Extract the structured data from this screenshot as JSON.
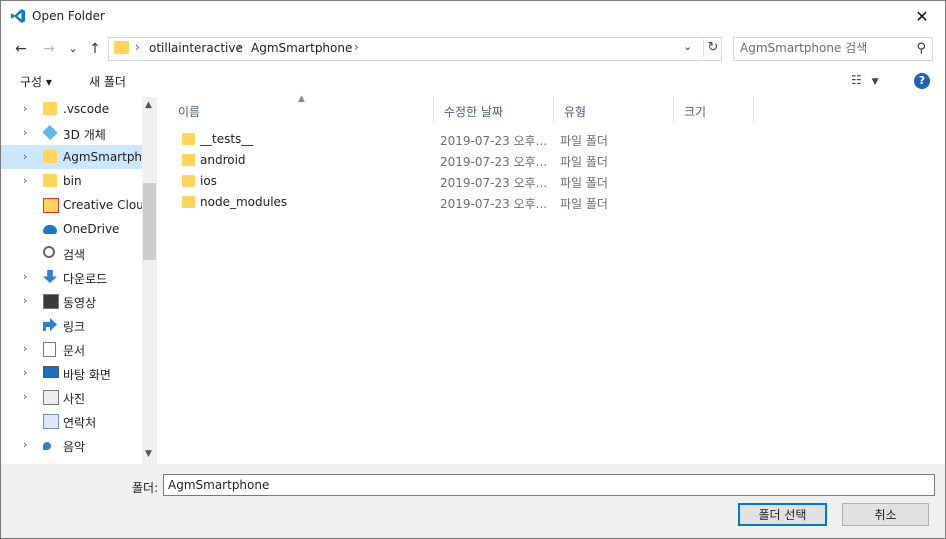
{
  "window": {
    "title": "Open Folder",
    "close_glyph": "✕"
  },
  "nav": {
    "back": "←",
    "forward": "→",
    "recent": "⌄",
    "up": "↑"
  },
  "address": {
    "breadcrumbs": [
      "otillainteractive",
      "AgmSmartphone"
    ],
    "separator": "›"
  },
  "search": {
    "placeholder": "AgmSmartphone 검색"
  },
  "toolbar": {
    "organize_label": "구성 ▾",
    "new_folder_label": "새 폴더",
    "help_label": "?"
  },
  "tree": {
    "items": [
      {
        "label": ".vscode",
        "icon": "folder-icon",
        "chevron": true,
        "selected": false
      },
      {
        "label": "3D 개체",
        "icon": "3d-objects-icon",
        "chevron": true,
        "selected": false
      },
      {
        "label": "AgmSmartphone",
        "icon": "folder-icon",
        "chevron": true,
        "selected": true
      },
      {
        "label": "bin",
        "icon": "folder-icon",
        "chevron": true,
        "selected": false
      },
      {
        "label": "Creative Cloud",
        "icon": "creative-cloud-icon",
        "chevron": false,
        "selected": false
      },
      {
        "label": "OneDrive",
        "icon": "onedrive-icon",
        "chevron": false,
        "selected": false
      },
      {
        "label": "검색",
        "icon": "search-icon",
        "chevron": false,
        "selected": false
      },
      {
        "label": "다운로드",
        "icon": "download-icon",
        "chevron": true,
        "selected": false
      },
      {
        "label": "동영상",
        "icon": "video-icon",
        "chevron": true,
        "selected": false
      },
      {
        "label": "링크",
        "icon": "link-icon",
        "chevron": false,
        "selected": false
      },
      {
        "label": "문서",
        "icon": "document-icon",
        "chevron": true,
        "selected": false
      },
      {
        "label": "바탕 화면",
        "icon": "desktop-icon",
        "chevron": true,
        "selected": false
      },
      {
        "label": "사진",
        "icon": "picture-icon",
        "chevron": true,
        "selected": false
      },
      {
        "label": "연락처",
        "icon": "contacts-icon",
        "chevron": false,
        "selected": false
      },
      {
        "label": "음악",
        "icon": "music-icon",
        "chevron": true,
        "selected": false
      }
    ]
  },
  "columns": {
    "name": "이름",
    "date": "수정한 날짜",
    "type": "유형",
    "size": "크기"
  },
  "files": [
    {
      "name": "__tests__",
      "date": "2019-07-23 오후...",
      "type": "파일 폴더"
    },
    {
      "name": "android",
      "date": "2019-07-23 오후...",
      "type": "파일 폴더"
    },
    {
      "name": "ios",
      "date": "2019-07-23 오후...",
      "type": "파일 폴더"
    },
    {
      "name": "node_modules",
      "date": "2019-07-23 오후...",
      "type": "파일 폴더"
    }
  ],
  "footer": {
    "folder_label": "폴더:",
    "folder_value": "AgmSmartphone",
    "select_button": "폴더 선택",
    "cancel_button": "취소"
  },
  "colors": {
    "accent": "#0078d7",
    "selection": "#cce8ff",
    "folder": "#ffd55c",
    "help": "#1e63b3"
  }
}
